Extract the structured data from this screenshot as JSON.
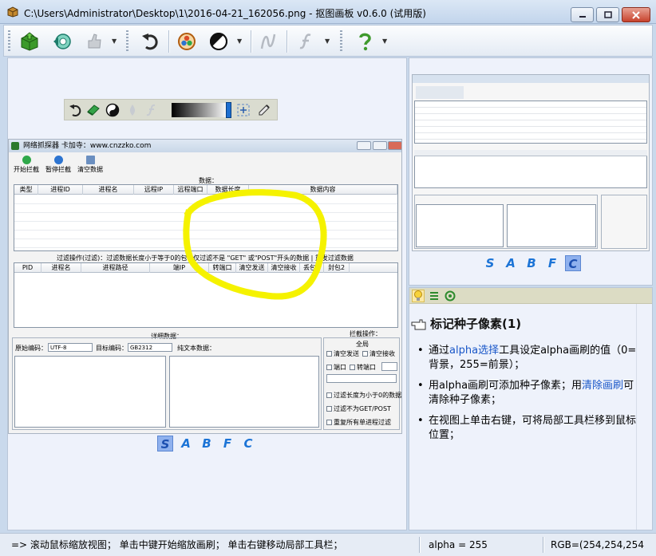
{
  "window": {
    "title": "C:\\Users\\Administrator\\Desktop\\1\\2016-04-21_162056.png - 抠图画板 v0.6.0 (试用版)"
  },
  "toolbar": {
    "icons": [
      "open-box-icon",
      "refresh-icon",
      "thumb-icon",
      "undo-icon",
      "alpha-icon",
      "contrast-icon",
      "curve-icon",
      "script-f-icon",
      "help-icon"
    ]
  },
  "local_toolbar": {
    "icons": [
      "undo-icon",
      "eraser-icon",
      "yin-yang-icon",
      "drop-icon",
      "script-f-icon",
      "crosshair-icon",
      "pen-icon"
    ]
  },
  "canvas_image": {
    "title": "网络抓探器  卡加寺：www.cnzzko.com",
    "buttons": [
      "开始拦截",
      "暂停拦截",
      "清空数据"
    ],
    "data_caption": "数据：",
    "data_columns": [
      "类型",
      "进程ID",
      "进程名",
      "远程IP",
      "远程端口",
      "数据长度",
      "数据内容"
    ],
    "filter_caption": "过滤操作(过滤)：过滤数据长度小于等于0的包 | 仅过滤不是 \"GET\" 或\"POST\"开头的数据 | 重发过滤数据",
    "proc_columns": [
      "PID",
      "进程名",
      "进程路径",
      "端IP",
      "转端口",
      "清空发送",
      "清空接收",
      "丢包1",
      "封包2"
    ],
    "detail_caption": "详细数据：",
    "source_encoding_label": "原始编码：",
    "source_encoding_value": "UTF-8",
    "target_encoding_label": "目标编码：",
    "target_encoding_value": "GB2312",
    "plain_text_label": "纯文本数据：",
    "options_caption": "拦截操作：",
    "options_global": "全局",
    "options": [
      "清空发送",
      "清空接收",
      "端口",
      "转端口",
      "过滤长度为小于0的数据",
      "过滤不为GET/POST",
      "重复所有单进程过滤"
    ]
  },
  "channels": [
    "S",
    "A",
    "B",
    "F",
    "C"
  ],
  "left_active_channel": "S",
  "right_active_channel": "C",
  "help": {
    "title": "标记种子像素(1)",
    "items": [
      {
        "pre": "通过",
        "link": "alpha选择",
        "post": "工具设定alpha画刷的值（0=背景，255=前景）；"
      },
      {
        "pre": "用alpha画刷可添加种子像素；用",
        "link": "清除画刷",
        "post": "可清除种子像素；"
      },
      {
        "pre": "在视图上单击右键，可将局部工具栏移到鼠标位置；",
        "link": "",
        "post": ""
      }
    ]
  },
  "status": {
    "hint": "=> 滚动鼠标缩放视图； 单击中键开始缩放画刷； 单击右键移动局部工具栏；",
    "alpha": "alpha = 255",
    "rgb": "RGB=(254,254,254"
  },
  "colors": {
    "accent": "#1c74d6",
    "scribble": "#f5f200",
    "link": "#1856c8"
  }
}
